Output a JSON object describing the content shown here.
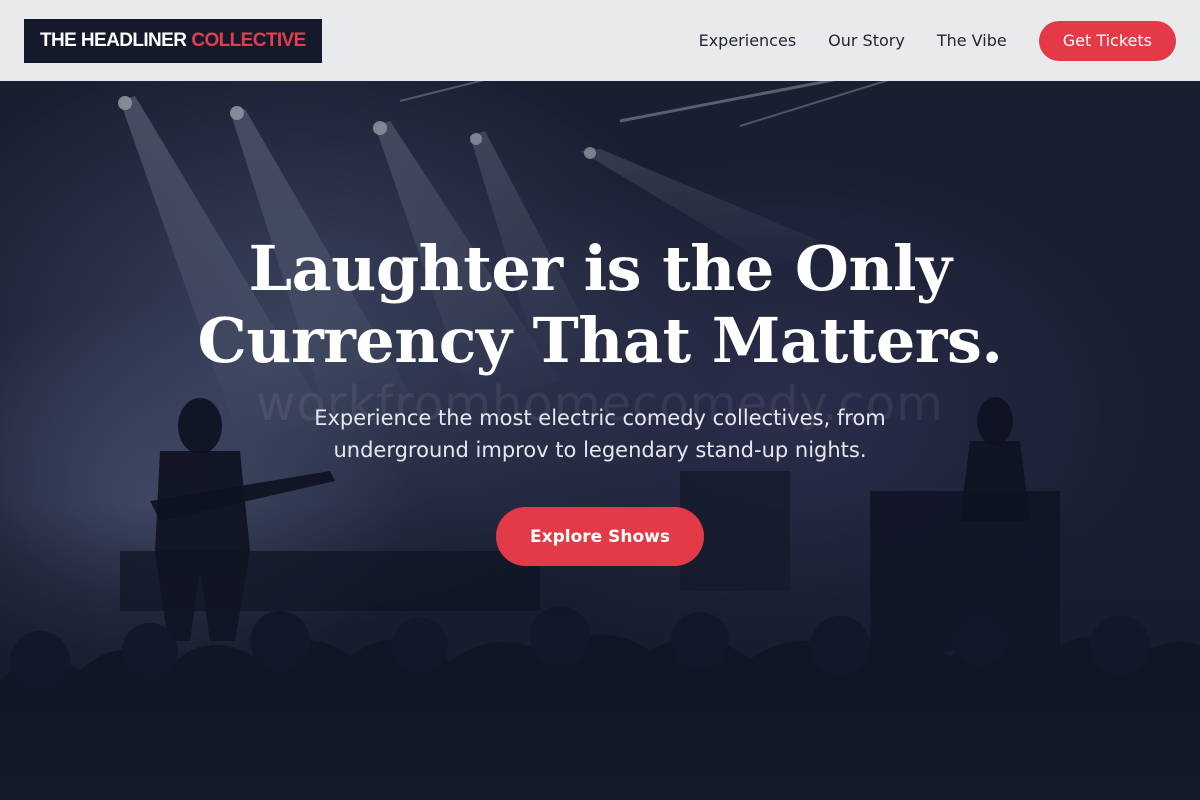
{
  "header": {
    "logo_part1": "THE HEADLINER",
    "logo_part2": "COLLECTIVE",
    "nav": [
      {
        "label": "Experiences"
      },
      {
        "label": "Our Story"
      },
      {
        "label": "The Vibe"
      }
    ],
    "cta_label": "Get Tickets"
  },
  "hero": {
    "headline_line1": "Laughter is the Only",
    "headline_line2": "Currency That Matters.",
    "subtext_line1": "Experience the most electric comedy collectives, from",
    "subtext_line2": "underground improv to legendary stand-up nights.",
    "cta_label": "Explore Shows",
    "watermark": "workfromhomecomedy.com",
    "background": "concert-stage-photo"
  },
  "colors": {
    "accent": "#e43947",
    "header_bg": "#e9eaec",
    "logo_bg": "#141a2c",
    "hero_overlay": "#141a2a"
  }
}
